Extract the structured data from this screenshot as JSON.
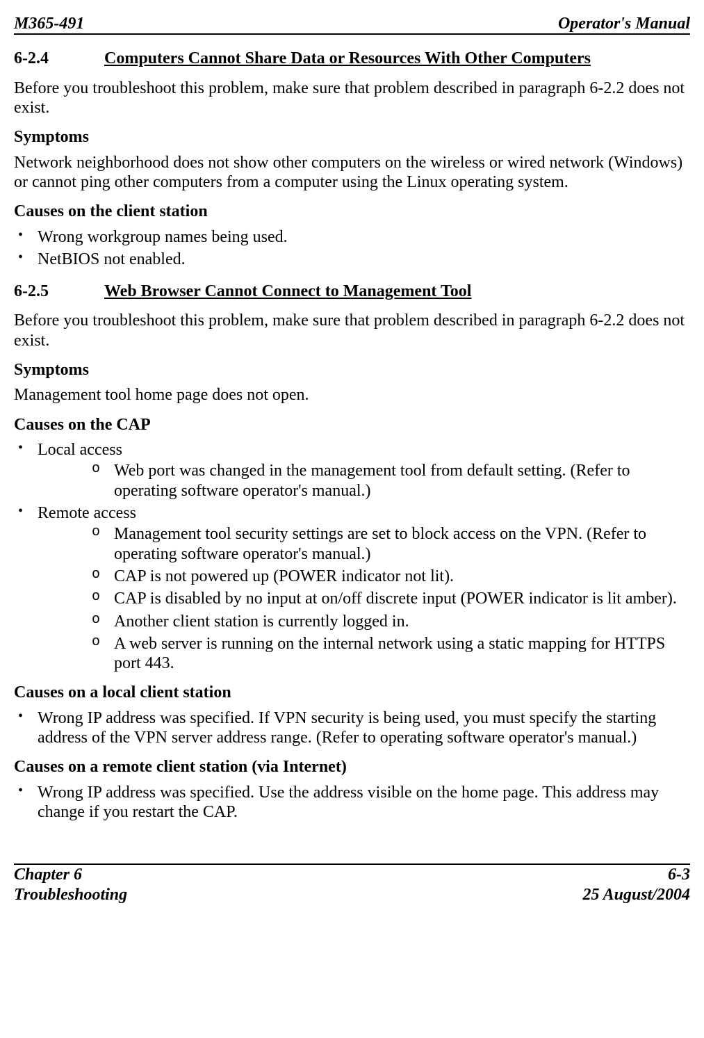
{
  "header": {
    "left": "M365-491",
    "right": "Operator's Manual"
  },
  "section_624": {
    "num": "6-2.4",
    "title": "Computers Cannot Share Data or Resources With Other Computers",
    "intro": "Before you troubleshoot this problem, make sure that problem described in paragraph 6-2.2 does not exist.",
    "symptoms_label": "Symptoms",
    "symptoms_text": "Network neighborhood does not show other computers on the wireless or wired network (Windows) or cannot ping other computers from a computer using the Linux operating system.",
    "causes_client_label": "Causes on the client station",
    "causes_client": [
      "Wrong workgroup names being used.",
      "NetBIOS not enabled."
    ]
  },
  "section_625": {
    "num": "6-2.5",
    "title": "Web Browser Cannot Connect to Management Tool ",
    "intro": "Before you troubleshoot this problem, make sure that problem described in paragraph 6-2.2 does not exist.",
    "symptoms_label": "Symptoms",
    "symptoms_text": "Management tool home page does not open.",
    "causes_cap_label": "Causes on the CAP",
    "causes_cap": {
      "local_label": "Local access",
      "local_items": [
        "Web port was changed in the management tool from default setting.  (Refer to operating software operator's manual.)"
      ],
      "remote_label": "Remote access",
      "remote_items": [
        "Management tool security settings are set to block access on the VPN.  (Refer to operating software operator's manual.)",
        "CAP is not powered up (POWER indicator not lit).",
        "CAP is disabled by no input at on/off discrete input (POWER indicator is lit amber).",
        "Another client station is currently logged in.",
        "A web server is running on the internal network using a static mapping for HTTPS port 443."
      ]
    },
    "causes_local_client_label": "Causes on a local client station",
    "causes_local_client": [
      "Wrong IP address was specified.  If VPN security is being used, you must specify the starting address of the VPN server address range.  (Refer to operating software operator's manual.)"
    ],
    "causes_remote_client_label": "Causes on a remote client station (via Internet)",
    "causes_remote_client": [
      "Wrong IP address was specified.  Use the address visible on the home page.  This address may change if you restart the CAP."
    ]
  },
  "footer": {
    "left_top": "Chapter 6",
    "left_bottom": "Troubleshooting",
    "right_top": "6-3",
    "right_bottom": "25 August/2004"
  }
}
